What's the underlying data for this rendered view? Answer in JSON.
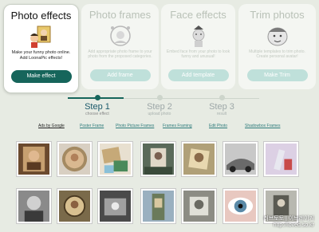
{
  "cards": [
    {
      "title": "Photo effects",
      "desc": "Make your funny photo online. Add LoonaPic effects!",
      "button": "Make effect",
      "active": true
    },
    {
      "title": "Photo frames",
      "desc": "Add appropriate photo frame to your photo from the proposed categories.",
      "button": "Add frame",
      "active": false
    },
    {
      "title": "Face effects",
      "desc": "Embed face from your photo to look funny and unusual!",
      "button": "Add template",
      "active": false
    },
    {
      "title": "Trim photos",
      "desc": "Multiple templates to trim photo. Create personal avatar!",
      "button": "Make Trim",
      "active": false
    }
  ],
  "steps": [
    {
      "label": "Step 1",
      "sub": "choose effect"
    },
    {
      "label": "Step 2",
      "sub": "upload photo"
    },
    {
      "label": "Step 3",
      "sub": "result"
    }
  ],
  "ads": {
    "by": "Ads by Google",
    "links": [
      "Poster Frame",
      "Photo Picture Frames",
      "Frames Framing",
      "Edit Photo",
      "Shadowbox Frames"
    ]
  },
  "watermark": {
    "line1": "러브토토 | 이브레이커",
    "line2": "http://loved.so.kr"
  },
  "colors": {
    "accent": "#16655b",
    "accent_light": "#bfe0da",
    "background": "#e7ebe3"
  }
}
